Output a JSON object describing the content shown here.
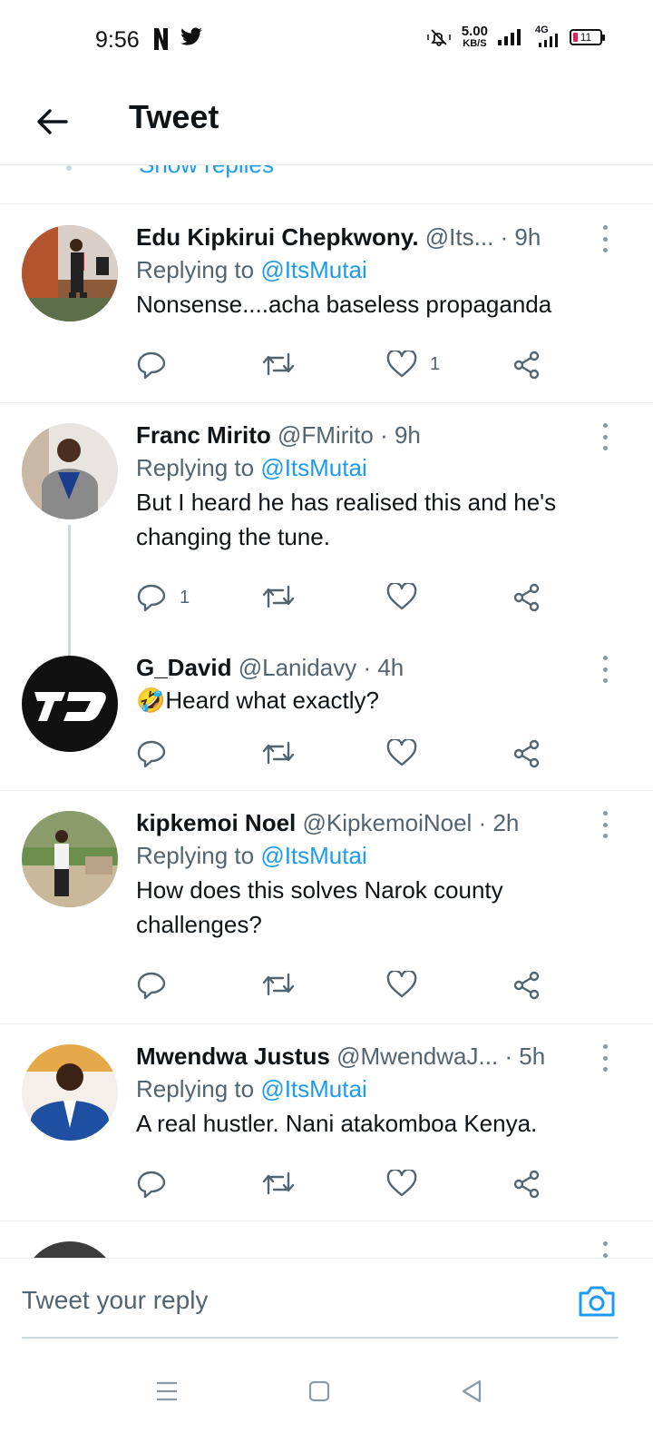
{
  "status_bar": {
    "time": "9:56",
    "speed_value": "5.00",
    "speed_unit": "KB/S",
    "network": "4G",
    "battery": "11"
  },
  "header": {
    "title": "Tweet"
  },
  "show_replies": "Show replies",
  "tweets": [
    {
      "name": "Edu Kipkirui Chepkwony.",
      "handle": "@Its...",
      "time": "· 9h",
      "replying_prefix": "Replying to",
      "replying_handle": "@ItsMutai",
      "text": "Nonsense....acha baseless propaganda",
      "reply_count": "",
      "like_count": "1"
    },
    {
      "name": "Franc Mirito",
      "handle": "@FMirito",
      "time": "· 9h",
      "replying_prefix": "Replying to",
      "replying_handle": "@ItsMutai",
      "text": "But I heard he has realised this and he's changing the tune.",
      "reply_count": "1",
      "like_count": ""
    },
    {
      "name": "G_David",
      "handle": "@Lanidavy",
      "time": "· 4h",
      "text": "🤣Heard what exactly?",
      "reply_count": "",
      "like_count": ""
    },
    {
      "name": "kipkemoi Noel",
      "handle": "@KipkemoiNoel",
      "time": "· 2h",
      "replying_prefix": "Replying to",
      "replying_handle": "@ItsMutai",
      "text": "How does this solves Narok county challenges?",
      "reply_count": "",
      "like_count": ""
    },
    {
      "name": "Mwendwa Justus",
      "handle": "@MwendwaJ...",
      "time": "· 5h",
      "replying_prefix": "Replying to",
      "replying_handle": "@ItsMutai",
      "text": "A real hustler. Nani atakomboa Kenya.",
      "reply_count": "",
      "like_count": ""
    }
  ],
  "reply_bar": {
    "placeholder": "Tweet your reply"
  },
  "colors": {
    "accent": "#1d9bf0",
    "muted": "#536471",
    "text": "#0f1419",
    "divider": "#e6ecf0"
  },
  "icons": [
    "back-arrow-icon",
    "reply-icon",
    "retweet-icon",
    "like-icon",
    "share-icon",
    "more-icon",
    "camera-icon",
    "menu-icon",
    "home-icon",
    "back-nav-icon"
  ]
}
